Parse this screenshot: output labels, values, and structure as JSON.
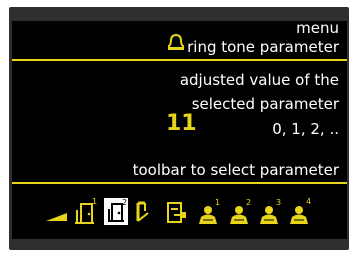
{
  "screen": {
    "menu_label": "menu",
    "parameter_label": "ring tone parameter",
    "adjusted_line1": "adjusted value of the",
    "adjusted_line2": "selected parameter",
    "value": "11",
    "range": "0, 1, 2, ..",
    "toolbar_label": "toolbar to select parameter"
  },
  "toolbar": {
    "items": [
      {
        "icon": "volume-ramp-icon"
      },
      {
        "icon": "door-bell-1-icon",
        "superscript": "1"
      },
      {
        "icon": "door-bell-2-icon",
        "superscript": "2",
        "selected": true
      },
      {
        "icon": "handset-icon"
      },
      {
        "icon": "door-panel-icon"
      },
      {
        "icon": "user-1-icon",
        "superscript": "1"
      },
      {
        "icon": "user-2-icon",
        "superscript": "2"
      },
      {
        "icon": "user-3-icon",
        "superscript": "3"
      },
      {
        "icon": "user-4-icon",
        "superscript": "4"
      }
    ]
  },
  "colors": {
    "accent": "#e8d51a",
    "background": "#000000",
    "text": "#ffffff",
    "frame": "#2f2f2f"
  }
}
